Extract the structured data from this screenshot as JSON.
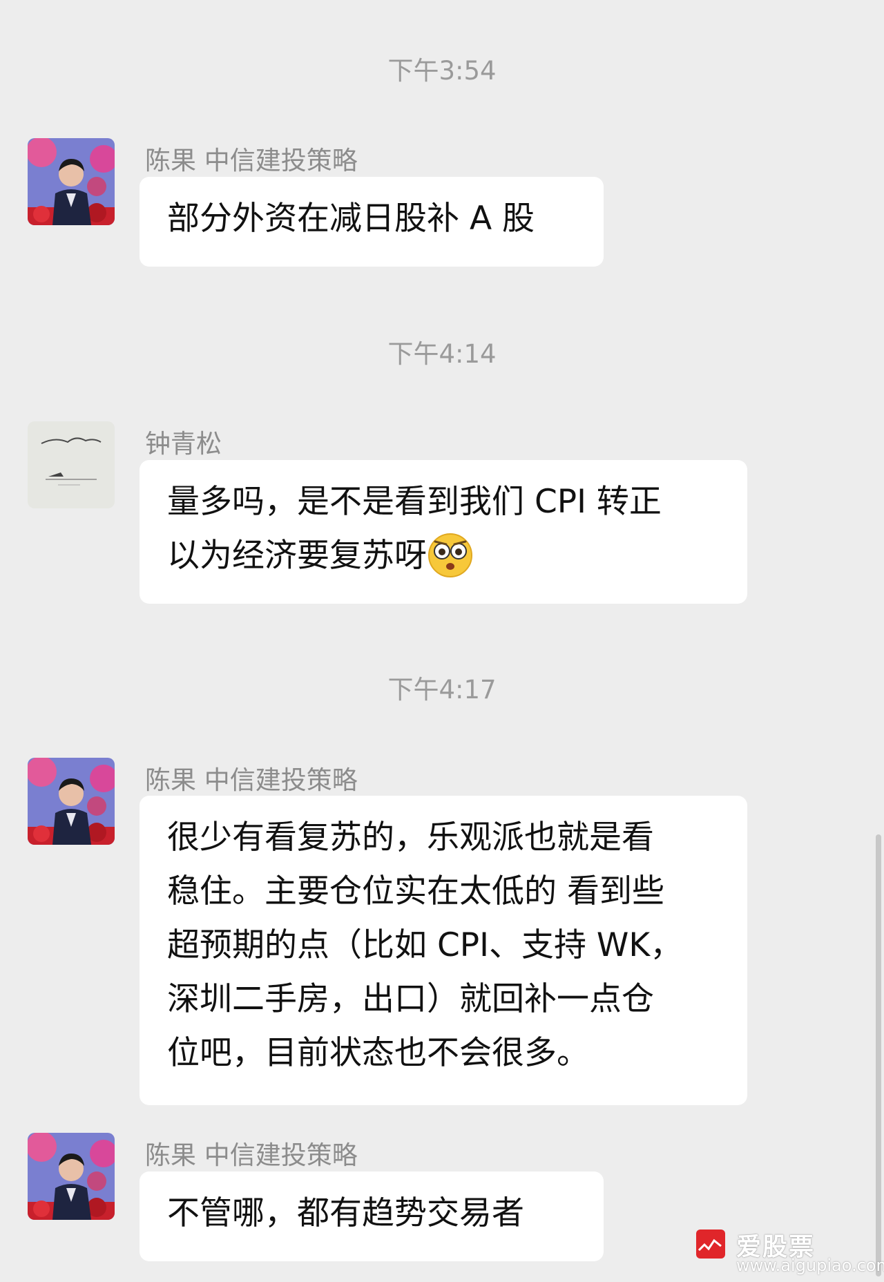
{
  "timestamps": [
    "下午3:54",
    "下午4:14",
    "下午4:17"
  ],
  "messages": [
    {
      "sender": "陈果 中信建投策略",
      "lines": [
        "部分外资在减日股补 A 股"
      ]
    },
    {
      "sender": "钟青松",
      "lines": [
        "量多吗，是不是看到我们 CPI 转正",
        "以为经济要复苏呀"
      ],
      "emoji": "flushed-face-emoji"
    },
    {
      "sender": "陈果 中信建投策略",
      "lines": [
        "很少有看复苏的，乐观派也就是看",
        "稳住。主要仓位实在太低的 看到些",
        "超预期的点（比如 CPI、支持 WK，",
        "深圳二手房，出口）就回补一点仓",
        "位吧，目前状态也不会很多。"
      ]
    },
    {
      "sender": "陈果 中信建投策略",
      "lines": [
        "不管哪，都有趋势交易者"
      ]
    }
  ],
  "watermark": {
    "brand": "爱股票",
    "url": "www.aigupiao.com",
    "logo_color": "#e0262a"
  },
  "colors": {
    "background": "#ededed",
    "bubble": "#ffffff",
    "timestamp_text": "#9a9a9a",
    "sender_text": "#8c8c8c"
  }
}
